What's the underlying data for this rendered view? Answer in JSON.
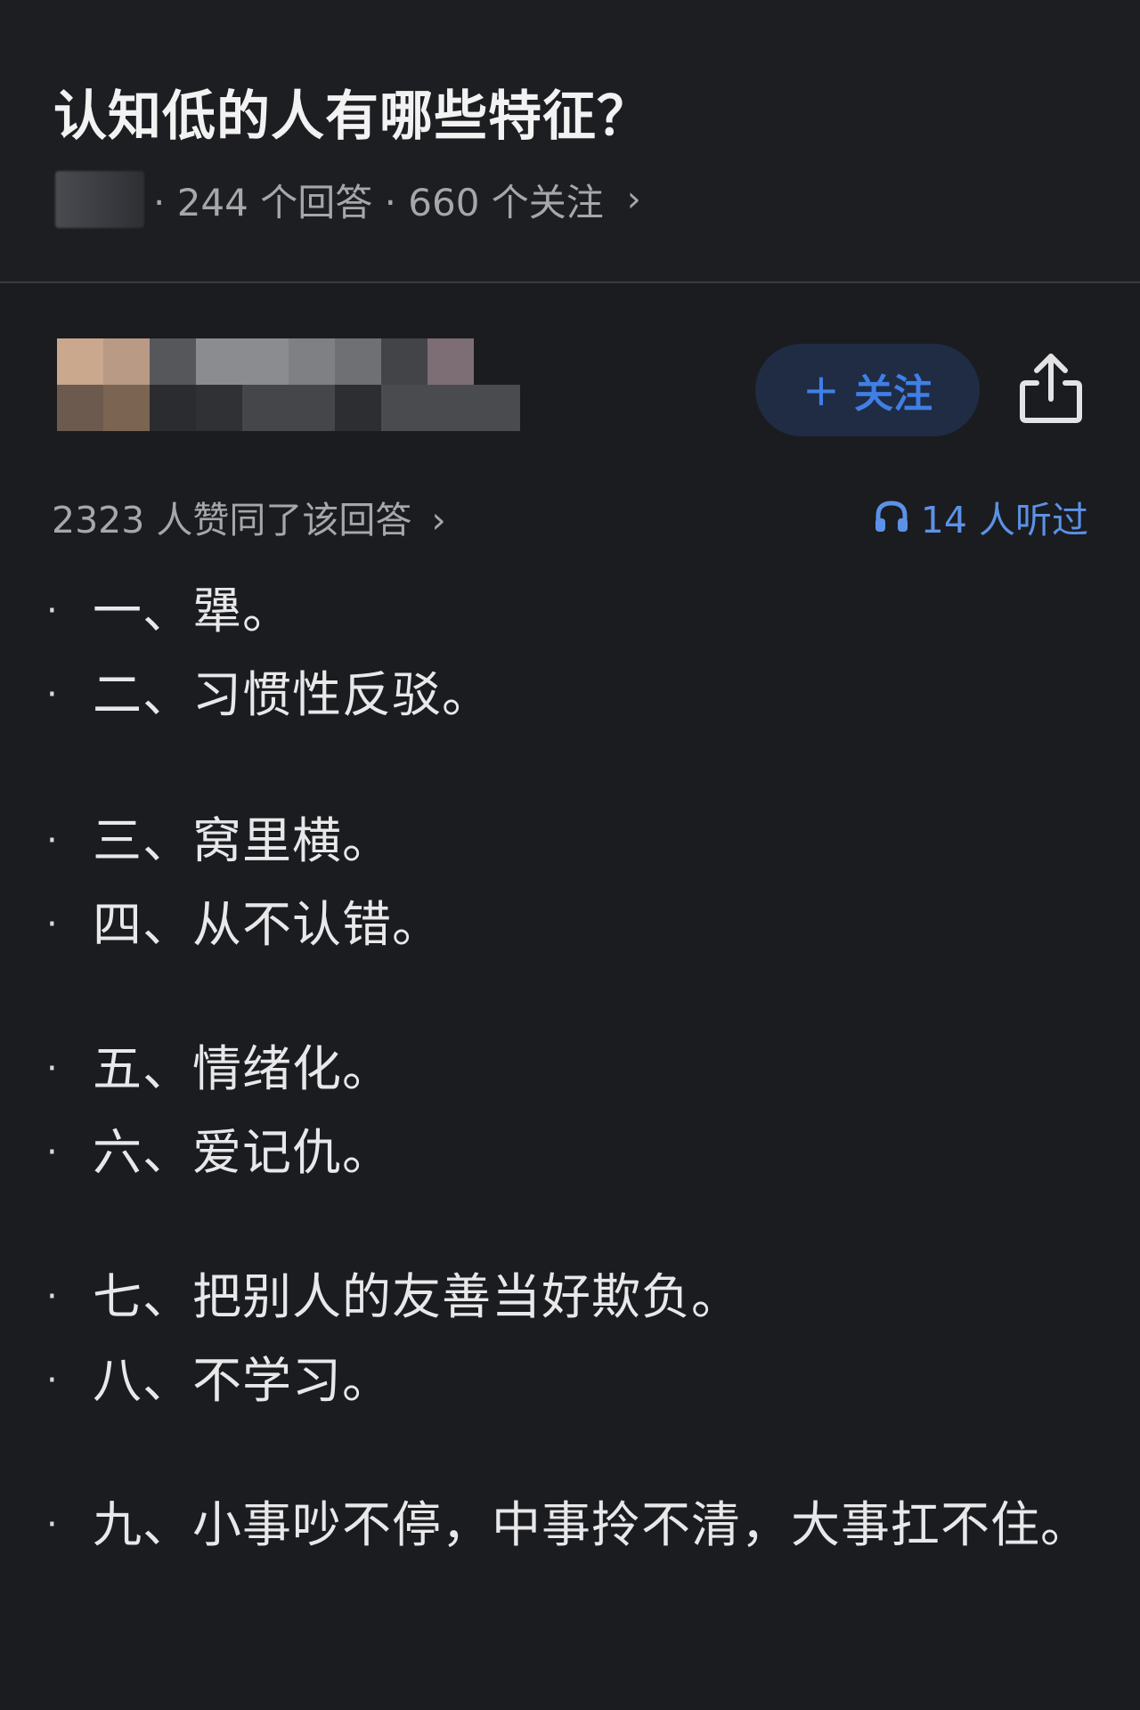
{
  "question": {
    "title": "认知低的人有哪些特征？",
    "meta_text": "· 244 个回答 · 660 个关注",
    "meta_chevron": "›"
  },
  "answer": {
    "follow_label": "关注",
    "follow_plus": "+",
    "upvote_text": "2323 人赞同了该回答",
    "upvote_chevron": "›",
    "listen_text": "14 人听过",
    "accent_color": "#3f7fe6",
    "items": [
      {
        "bullet": "·",
        "text": "一、犟。"
      },
      {
        "bullet": "·",
        "text": "二、习惯性反驳。"
      },
      {
        "bullet": "·",
        "text": "三、窝里横。"
      },
      {
        "bullet": "·",
        "text": "四、从不认错。"
      },
      {
        "bullet": "·",
        "text": "五、情绪化。"
      },
      {
        "bullet": "·",
        "text": "六、爱记仇。"
      },
      {
        "bullet": "·",
        "text": "七、把别人的友善当好欺负。"
      },
      {
        "bullet": "·",
        "text": "八、不学习。"
      },
      {
        "bullet": "·",
        "text": "九、小事吵不停，中事拎不清，大事扛不住。"
      }
    ]
  },
  "icons": {
    "share": "share-icon",
    "headphones": "headphones-icon"
  }
}
